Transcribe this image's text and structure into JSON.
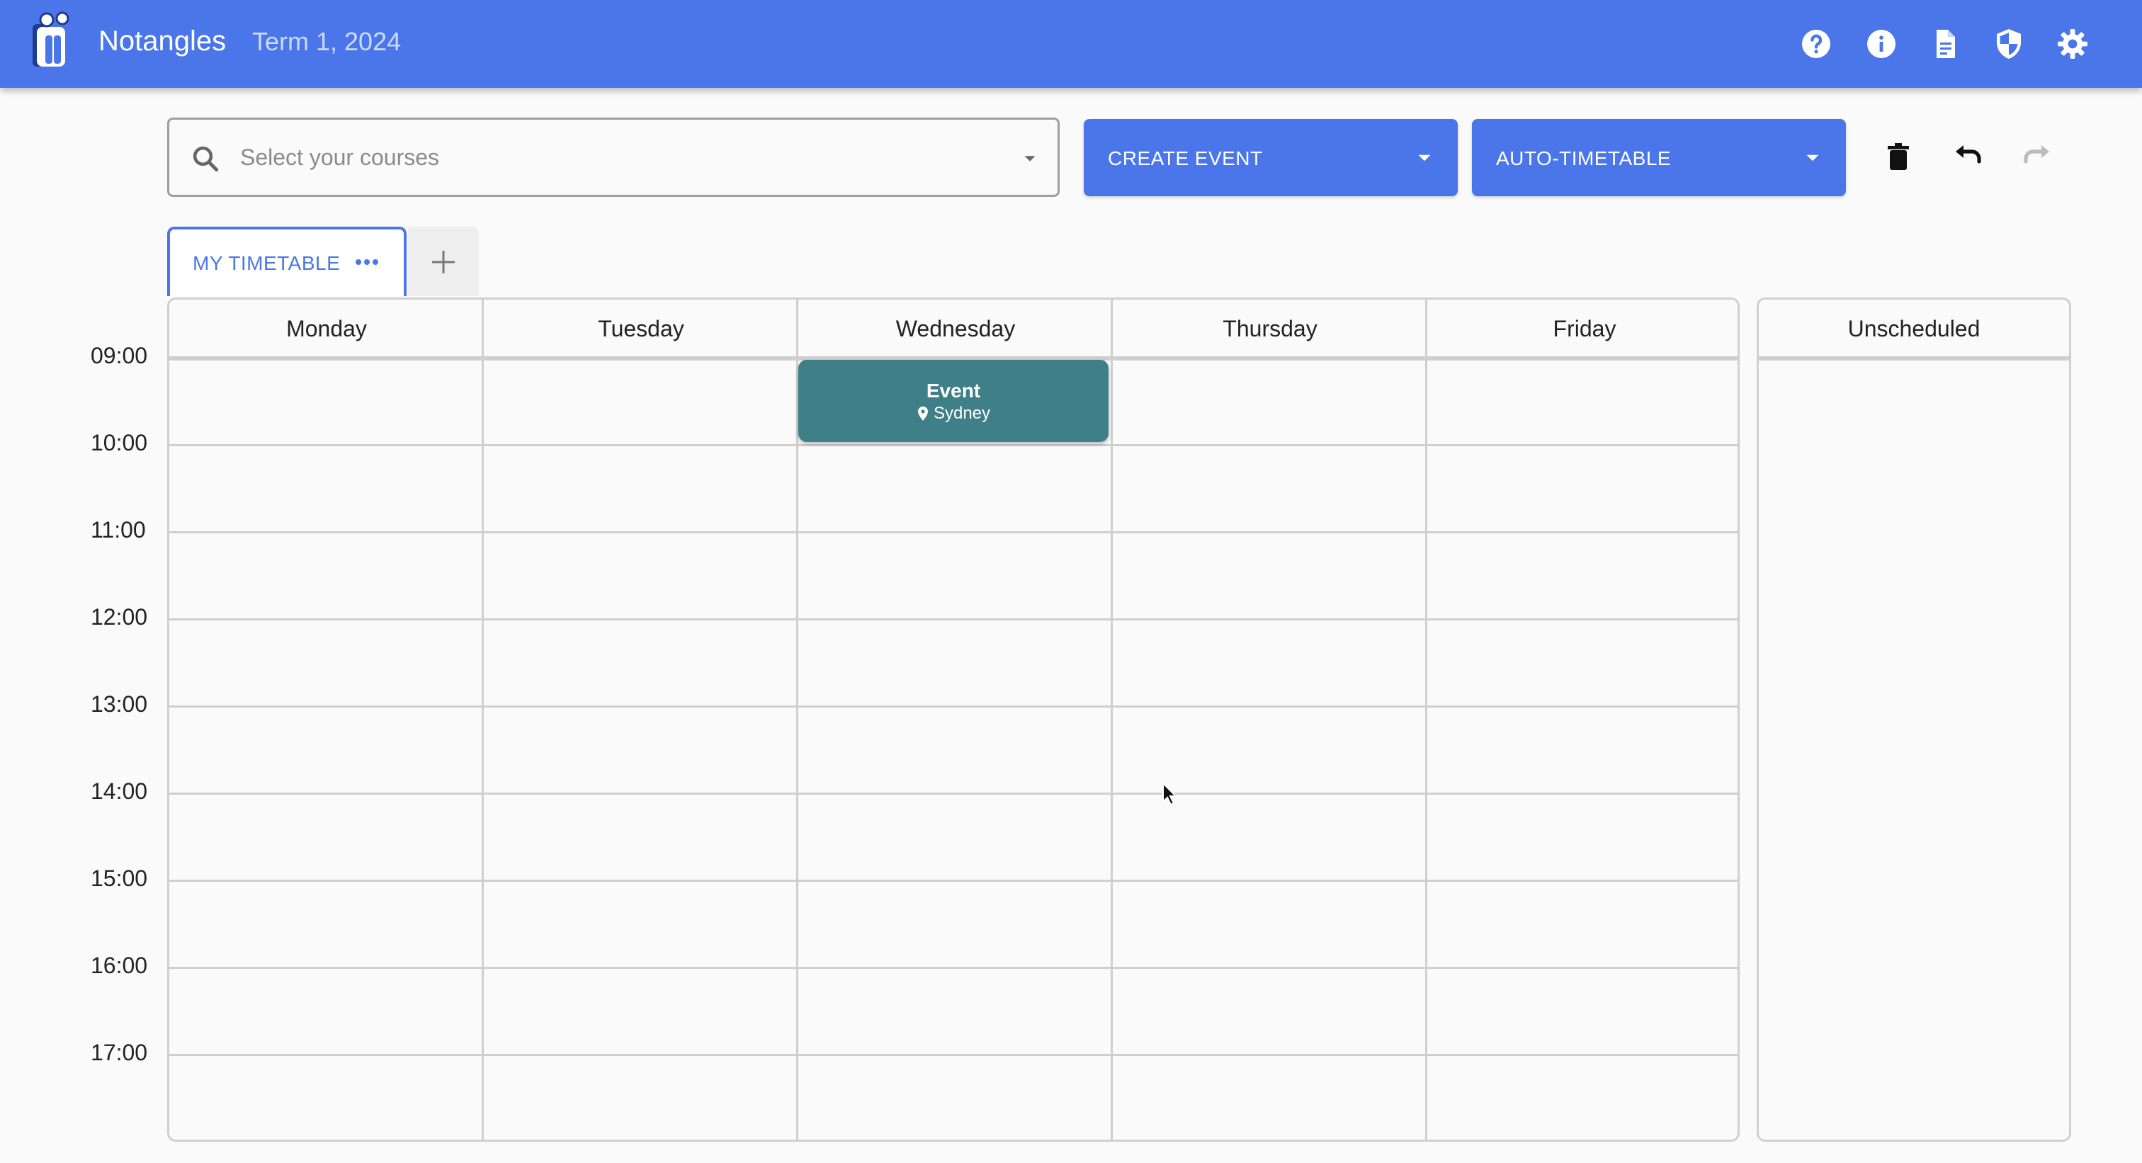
{
  "app": {
    "title": "Notangles",
    "term": "Term 1, 2024"
  },
  "header_icons": [
    {
      "name": "help-icon"
    },
    {
      "name": "info-icon"
    },
    {
      "name": "document-icon"
    },
    {
      "name": "privacy-shield-icon"
    },
    {
      "name": "settings-gear-icon"
    }
  ],
  "toolbar": {
    "search_placeholder": "Select your courses",
    "create_event_label": "CREATE EVENT",
    "auto_timetable_label": "AUTO-TIMETABLE"
  },
  "tabs": [
    {
      "label": "MY TIMETABLE",
      "active": true
    }
  ],
  "timetable": {
    "days": [
      "Monday",
      "Tuesday",
      "Wednesday",
      "Thursday",
      "Friday"
    ],
    "unscheduled_label": "Unscheduled",
    "times": [
      "09:00",
      "10:00",
      "11:00",
      "12:00",
      "13:00",
      "14:00",
      "15:00",
      "16:00",
      "17:00"
    ]
  },
  "events": [
    {
      "title": "Event",
      "location": "Sydney",
      "day": "Wednesday",
      "start": "09:00",
      "end": "10:00",
      "color": "#3f7f88"
    }
  ],
  "colors": {
    "primary": "#4a76ea",
    "event": "#3f7f88"
  }
}
